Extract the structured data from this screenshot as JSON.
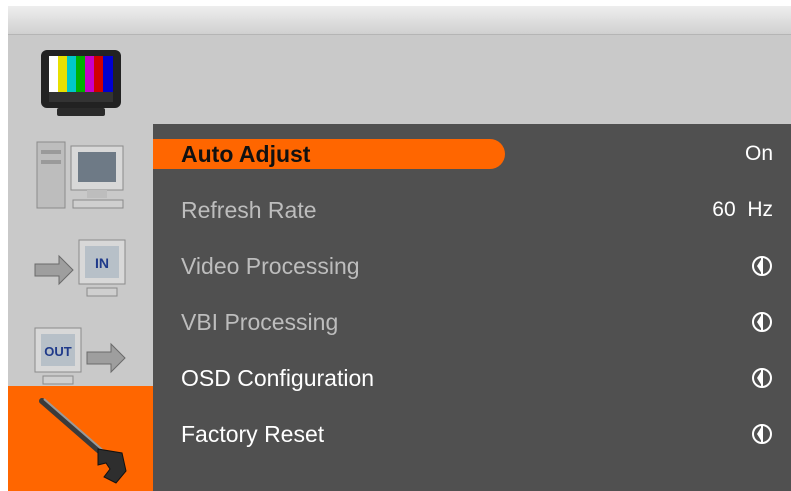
{
  "menu": {
    "items": [
      {
        "label": "Auto Adjust",
        "value": "On",
        "value_type": "text",
        "selected": true,
        "enabled": true
      },
      {
        "label": "Refresh Rate",
        "value": "60  Hz",
        "value_type": "text",
        "selected": false,
        "enabled": false
      },
      {
        "label": "Video Processing",
        "value": null,
        "value_type": "enter-icon",
        "selected": false,
        "enabled": false
      },
      {
        "label": "VBI Processing",
        "value": null,
        "value_type": "enter-icon",
        "selected": false,
        "enabled": false
      },
      {
        "label": "OSD Configuration",
        "value": null,
        "value_type": "enter-icon",
        "selected": false,
        "enabled": true
      },
      {
        "label": "Factory Reset",
        "value": null,
        "value_type": "enter-icon",
        "selected": false,
        "enabled": true
      }
    ]
  },
  "sidebar": {
    "items": [
      {
        "name": "picture",
        "icon": "color-bars-tv-icon",
        "selected": false
      },
      {
        "name": "computer",
        "icon": "computer-monitor-icon",
        "selected": false
      },
      {
        "name": "input",
        "icon": "input-arrow-icon",
        "icon_text": "IN",
        "selected": false
      },
      {
        "name": "output",
        "icon": "output-arrow-icon",
        "icon_text": "OUT",
        "selected": false
      },
      {
        "name": "tools",
        "icon": "wrench-icon",
        "selected": true
      }
    ]
  },
  "colors": {
    "accent": "#ff6600",
    "panel": "#505050",
    "background": "#c9c9c9",
    "text_active": "#ffffff",
    "text_dim": "#bdbdbd"
  }
}
